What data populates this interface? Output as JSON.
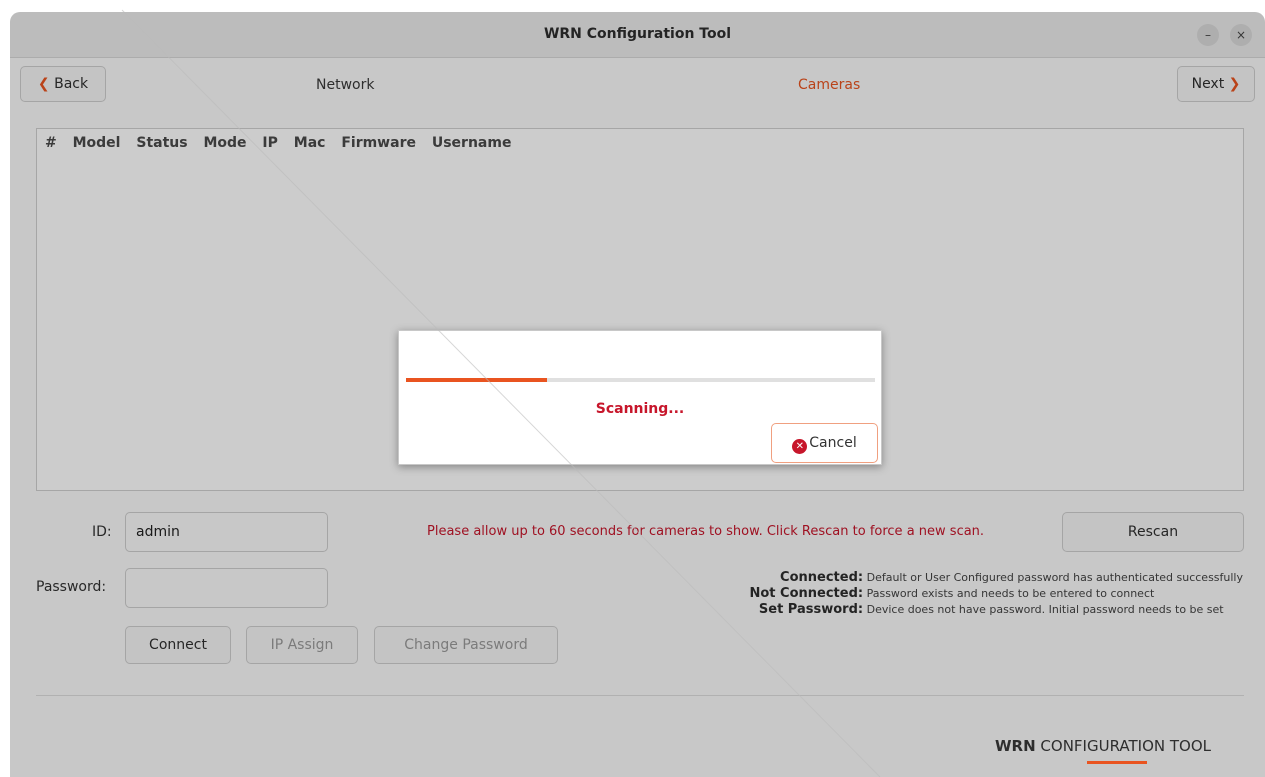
{
  "window": {
    "title": "WRN Configuration Tool",
    "minimize_glyph": "–",
    "close_glyph": "×"
  },
  "nav": {
    "back_chevron": "❮",
    "back_label": "Back",
    "network_label": "Network",
    "cameras_label": "Cameras",
    "next_label": "Next",
    "next_chevron": "❯"
  },
  "table": {
    "columns": [
      "#",
      "Model",
      "Status",
      "Mode",
      "IP",
      "Mac",
      "Firmware",
      "Username"
    ]
  },
  "form": {
    "id_label": "ID:",
    "id_value": "admin",
    "password_label": "Password:",
    "password_value": "",
    "connect_label": "Connect",
    "ip_assign_label": "IP Assign",
    "change_password_label": "Change Password"
  },
  "scan_note": "Please allow up to 60 seconds for cameras to show. Click Rescan to force a new scan.",
  "rescan_label": "Rescan",
  "legend": [
    {
      "key": "Connected:",
      "desc": "Default or User Configured password has authenticated successfully"
    },
    {
      "key": "Not Connected:",
      "desc": "Password exists and needs to be entered to connect"
    },
    {
      "key": "Set Password:",
      "desc": "Device does not have password. Initial password needs to be set"
    }
  ],
  "brand": {
    "bold": "WRN",
    "rest": " CONFIGURATION TOOL"
  },
  "dialog": {
    "status_text": "Scanning...",
    "progress": 0.3,
    "cancel_label": "Cancel",
    "cancel_icon": "✕"
  },
  "colors": {
    "accent": "#e95420",
    "error": "#c7162b"
  }
}
